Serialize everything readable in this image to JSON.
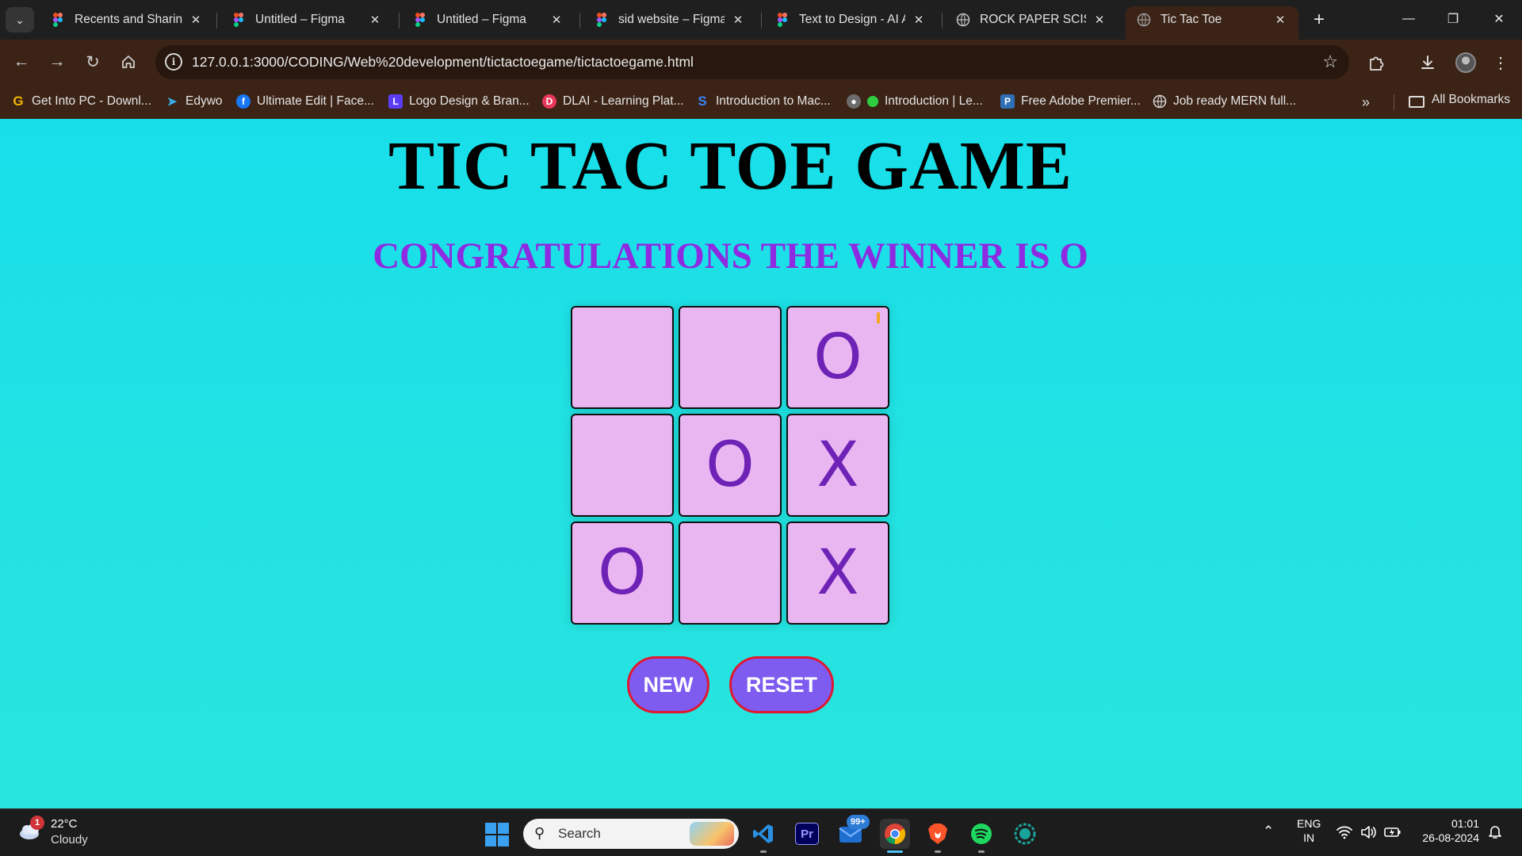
{
  "browser": {
    "tabs": [
      {
        "label": "Recents and Sharing",
        "icon": "figma-icon"
      },
      {
        "label": "Untitled – Figma",
        "icon": "figma-icon"
      },
      {
        "label": "Untitled – Figma",
        "icon": "figma-icon"
      },
      {
        "label": "sid website – Figma",
        "icon": "figma-icon"
      },
      {
        "label": "Text to Design - AI A",
        "icon": "figma-icon"
      },
      {
        "label": "ROCK PAPER SCISSO",
        "icon": "globe-icon"
      },
      {
        "label": "Tic Tac Toe",
        "icon": "globe-icon",
        "active": true
      }
    ],
    "url": "127.0.0.1:3000/CODING/Web%20development/tictactoegame/tictactoegame.html",
    "bookmarks": [
      {
        "label": "Get Into PC - Downl...",
        "icon": "g-icon"
      },
      {
        "label": "Edywo",
        "icon": "edywo-icon"
      },
      {
        "label": "Ultimate Edit | Face...",
        "icon": "facebook-icon"
      },
      {
        "label": "Logo Design & Bran...",
        "icon": "logo-design-icon"
      },
      {
        "label": "DLAI - Learning Plat...",
        "icon": "dlai-icon"
      },
      {
        "label": "Introduction to Mac...",
        "icon": "s-icon"
      },
      {
        "label": "Introduction | Le...",
        "icon": "green-dot-icon"
      },
      {
        "label": "Free Adobe Premier...",
        "icon": "premier-icon"
      },
      {
        "label": "Job ready MERN full...",
        "icon": "globe-icon"
      }
    ],
    "all_bookmarks": "All Bookmarks",
    "accent_tab_color": "#3b2316"
  },
  "game": {
    "title": "TIC TAC TOE GAME",
    "winner_message": "CONGRATULATIONS THE WINNER IS O",
    "board": [
      "",
      "",
      "O",
      "",
      "O",
      "X",
      "O",
      "",
      "X"
    ],
    "new_label": "NEW",
    "reset_label": "RESET",
    "colors": {
      "background": "#1fe1e6",
      "cell": "#eab6f2",
      "mark": "#6e22b6",
      "message": "#8e2be2",
      "button": "#7e5cf0",
      "button_border": "#e0182f"
    }
  },
  "taskbar": {
    "weather_temp": "22°C",
    "weather_condition": "Cloudy",
    "weather_badge": "1",
    "search_placeholder": "Search",
    "mail_badge": "99+",
    "language": "ENG",
    "region": "IN",
    "time": "01:01",
    "date": "26-08-2024"
  }
}
